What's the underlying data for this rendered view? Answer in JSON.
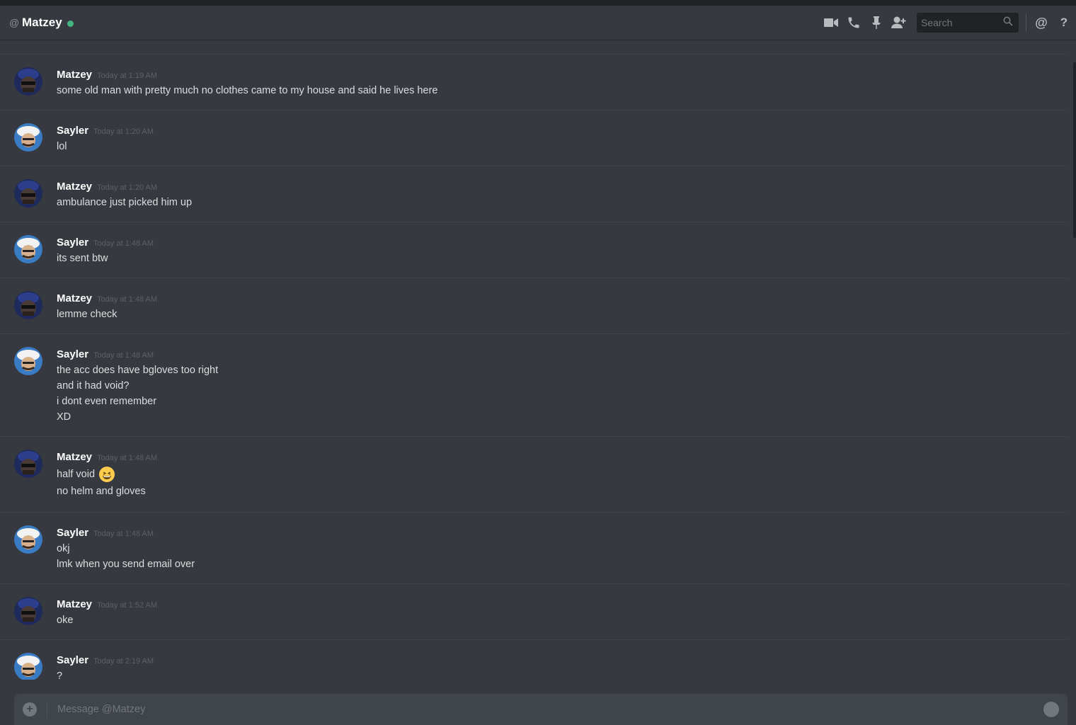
{
  "header": {
    "dm_name": "Matzey",
    "status_color": "#43b581",
    "search_placeholder": "Search",
    "icons": [
      "video-call-icon",
      "voice-call-icon",
      "pin-icon",
      "add-friend-icon",
      "search-icon",
      "mention-icon",
      "help-icon"
    ]
  },
  "messages": [
    {
      "author": "Matzey",
      "timestamp": "Today at 1:19 AM",
      "avatar": "matzey-avatar",
      "lines": [
        "some old man with pretty much no clothes came to my house and said he lives here"
      ]
    },
    {
      "author": "Sayler",
      "timestamp": "Today at 1:20 AM",
      "avatar": "sayler-avatar",
      "lines": [
        "lol"
      ]
    },
    {
      "author": "Matzey",
      "timestamp": "Today at 1:20 AM",
      "avatar": "matzey-avatar",
      "lines": [
        "ambulance just picked him up"
      ]
    },
    {
      "author": "Sayler",
      "timestamp": "Today at 1:48 AM",
      "avatar": "sayler-avatar",
      "lines": [
        "its sent btw"
      ]
    },
    {
      "author": "Matzey",
      "timestamp": "Today at 1:48 AM",
      "avatar": "matzey-avatar",
      "lines": [
        "lemme check"
      ]
    },
    {
      "author": "Sayler",
      "timestamp": "Today at 1:48 AM",
      "avatar": "sayler-avatar",
      "lines": [
        "the acc does have bgloves too right",
        "and it had void?",
        "i dont even remember",
        "XD"
      ]
    },
    {
      "author": "Matzey",
      "timestamp": "Today at 1:48 AM",
      "avatar": "matzey-avatar",
      "lines": [
        "half void",
        "no helm and gloves"
      ],
      "emoji_after_line": 0,
      "emoji": "grinning-squinting-face-icon"
    },
    {
      "author": "Sayler",
      "timestamp": "Today at 1:48 AM",
      "avatar": "sayler-avatar",
      "lines": [
        "okj",
        "lmk when you send email over"
      ]
    },
    {
      "author": "Matzey",
      "timestamp": "Today at 1:52 AM",
      "avatar": "matzey-avatar",
      "lines": [
        "oke"
      ]
    },
    {
      "author": "Sayler",
      "timestamp": "Today at 2:19 AM",
      "avatar": "sayler-avatar",
      "lines": [
        "?"
      ]
    }
  ],
  "composer": {
    "placeholder": "Message @Matzey"
  }
}
